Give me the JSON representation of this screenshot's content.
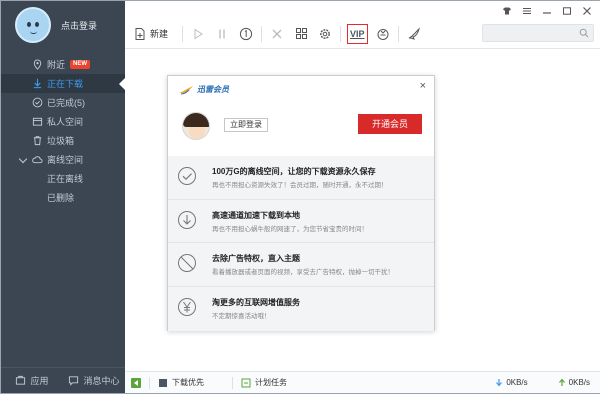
{
  "sidebar": {
    "login_text": "点击登录",
    "items": [
      {
        "label": "附近",
        "badge": "NEW"
      },
      {
        "label": "正在下载"
      },
      {
        "label": "已完成(5)"
      },
      {
        "label": "私人空间"
      },
      {
        "label": "垃圾箱"
      },
      {
        "label": "离线空间"
      },
      {
        "label": "正在离线"
      },
      {
        "label": "已删除"
      }
    ],
    "bottom": {
      "apps_label": "应用",
      "messages_label": "消息中心"
    }
  },
  "toolbar": {
    "new_label": "新建",
    "vip_label": "VIP"
  },
  "statusbar": {
    "download_priority": "下载优先",
    "scheduled_tasks": "计划任务",
    "download_speed": "0KB/s",
    "upload_speed": "0KB/s"
  },
  "popup": {
    "logo_text": "迅雷会员",
    "close_icon": "×",
    "login_button": "立即登录",
    "open_vip_button": "开通会员",
    "benefits": [
      {
        "icon": "check-circle-icon",
        "title": "100万G的离线空间，让您的下载资源永久保存",
        "desc": "再也不用担心资源失效了！会员过期，随时开通，永不过期！"
      },
      {
        "icon": "download-circle-icon",
        "title": "高速通道加速下载到本地",
        "desc": "再也不用担心蜗牛般的网速了，为您节省宝贵的时间！"
      },
      {
        "icon": "no-ads-icon",
        "title": "去除广告特权，直入主题",
        "desc": "看着播放器或者页面的视频，享受去广告特权，抛掉一切干扰！"
      },
      {
        "icon": "yuan-circle-icon",
        "title": "淘更多的互联网增值服务",
        "desc": "不定期惊喜活动哦！"
      }
    ]
  },
  "colors": {
    "sidebar_bg": "#3b4652",
    "active_text": "#3d9bf2",
    "vip_red": "#d92a2a",
    "new_badge": "#e8442e"
  }
}
